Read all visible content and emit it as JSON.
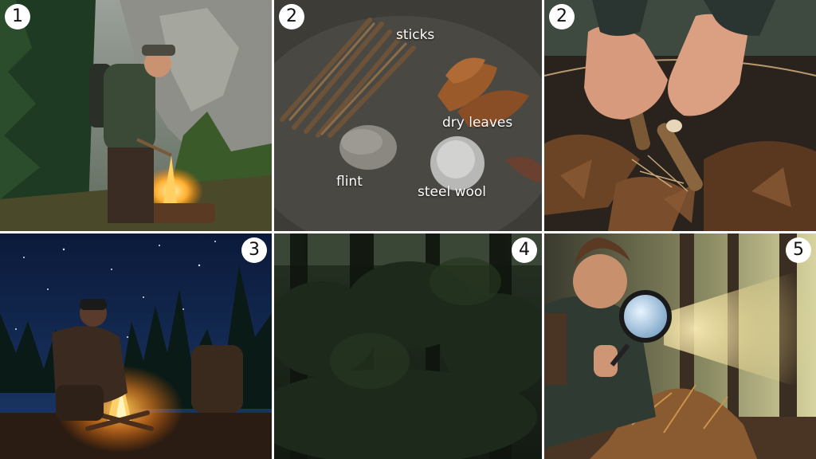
{
  "panels": [
    {
      "step": "1"
    },
    {
      "step": "2",
      "labels": {
        "sticks": "sticks",
        "dry_leaves": "dry leaves",
        "flint": "flint",
        "steel_wool": "steel wool"
      }
    },
    {
      "step": "2"
    },
    {
      "step": "3"
    },
    {
      "step": "4"
    },
    {
      "step": "5"
    }
  ]
}
